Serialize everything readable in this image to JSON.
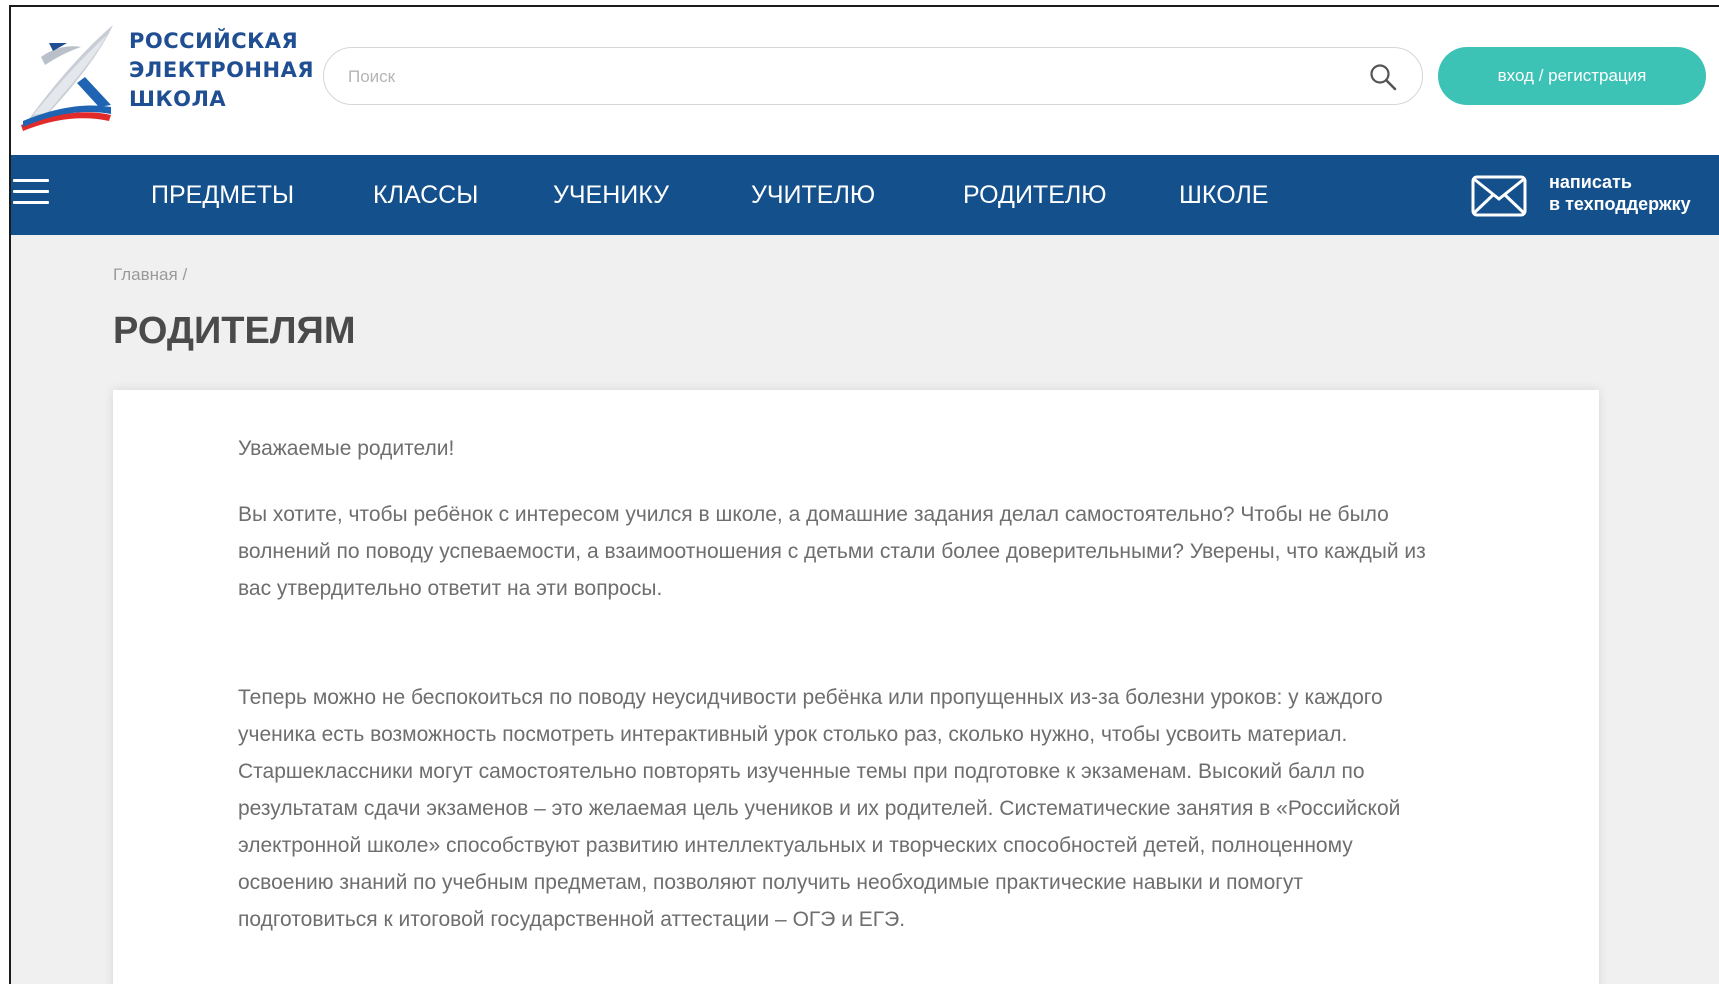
{
  "header": {
    "logo_lines": [
      "РОССИЙСКАЯ",
      "ЭЛЕКТРОННАЯ",
      "ШКОЛА"
    ],
    "search_placeholder": "Поиск",
    "search_value": "",
    "login_label": "вход / регистрация",
    "icons": {
      "search": "search-icon",
      "logo": "rosh-logo-icon"
    }
  },
  "nav": {
    "menu_icon": "hamburger-menu-icon",
    "items": [
      {
        "label": "ПРЕДМЕТЫ"
      },
      {
        "label": "КЛАССЫ"
      },
      {
        "label": "УЧЕНИКУ"
      },
      {
        "label": "УЧИТЕЛЮ"
      },
      {
        "label": "РОДИТЕЛЮ"
      },
      {
        "label": "ШКОЛЕ"
      }
    ],
    "support": {
      "icon": "mail-icon",
      "line1": "написать",
      "line2": "в техподдержку"
    }
  },
  "breadcrumb": {
    "home": "Главная",
    "separator": "/"
  },
  "page_title": "РОДИТЕЛЯМ",
  "content": {
    "greeting": "Уважаемые родители!",
    "paragraph1": "Вы хотите, чтобы ребёнок с интересом учился в школе, а домашние задания делал самостоятельно? Чтобы не было волнений по поводу успеваемости, а взаимоотношения с детьми стали более доверительными? Уверены, что каждый из вас утвердительно ответит на эти вопросы.",
    "paragraph2": "Теперь можно не беспокоиться по поводу неусидчивости ребёнка или пропущенных из-за болезни уроков: у каждого ученика есть возможность посмотреть интерактивный урок столько раз, сколько нужно, чтобы усвоить материал. Старшеклассники могут самостоятельно повторять изученные темы при подготовке к экзаменам. Высокий балл по результатам сдачи экзаменов – это желаемая цель учеников и их родителей. Систематические занятия в «Российской электронной школе» способствуют развитию интеллектуальных и творческих способностей детей, полноценному освоению знаний по учебным предметам, позволяют получить необходимые практические навыки и помогут подготовиться к итоговой государственной аттестации – ОГЭ и ЕГЭ."
  },
  "colors": {
    "nav_background": "#14508c",
    "login_button": "#3cc3b5",
    "logo_text": "#1f4e92",
    "page_background": "#f0f0f0"
  }
}
